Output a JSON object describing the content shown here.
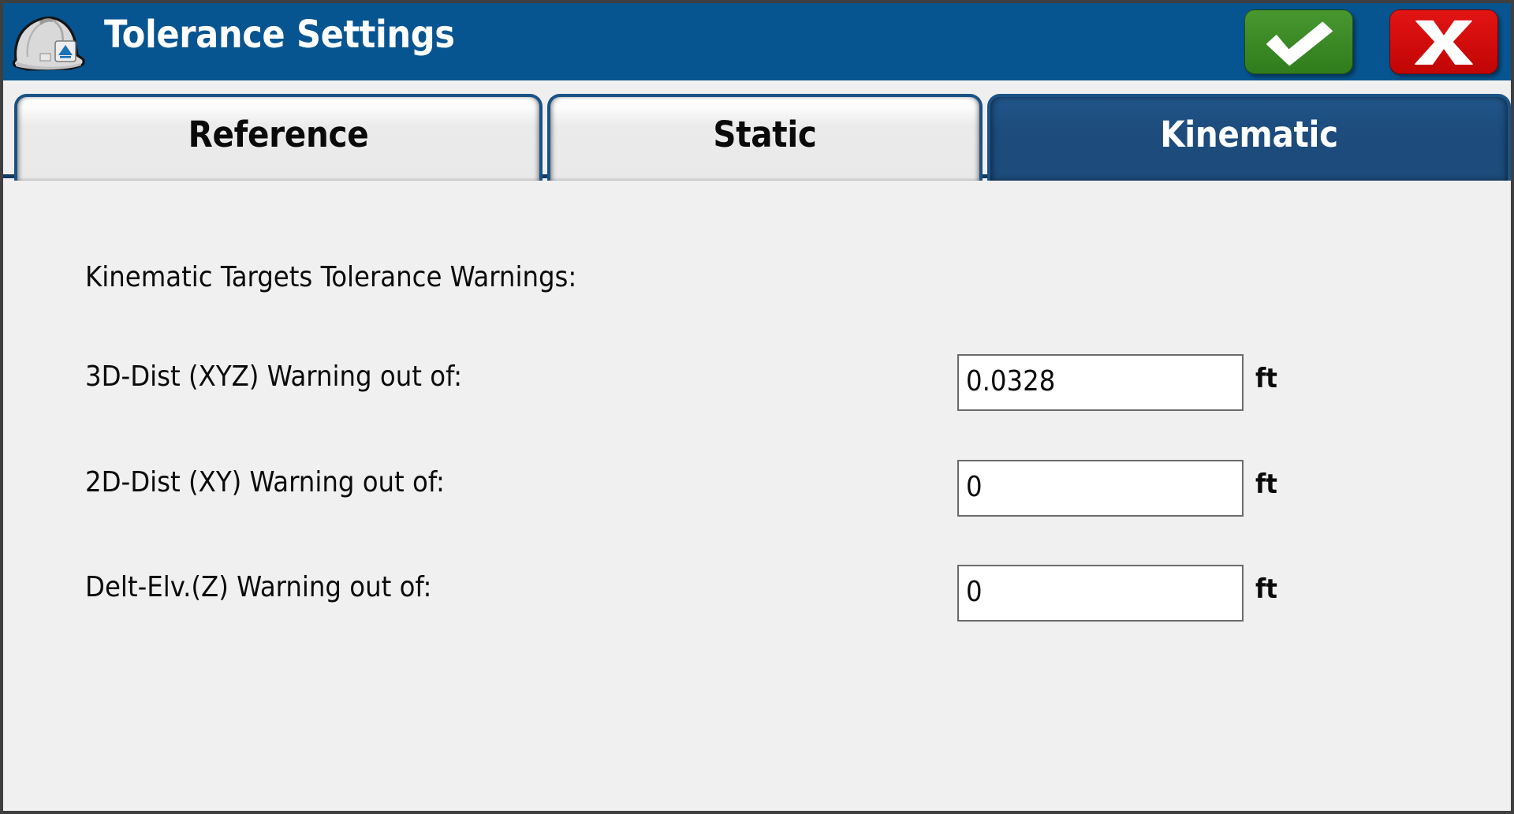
{
  "window": {
    "title": "Tolerance Settings",
    "icon": "hard-hat-icon"
  },
  "titlebar": {
    "accept_label": "✓",
    "cancel_label": "X",
    "accept_icon": "checkmark-icon",
    "cancel_icon": "x-mark-icon",
    "accept_color": "#3d8b27",
    "cancel_color": "#d40d0d",
    "background_color": "#065591"
  },
  "tabs": [
    {
      "id": "reference",
      "label": "Reference",
      "active": false
    },
    {
      "id": "static",
      "label": "Static",
      "active": false
    },
    {
      "id": "kinematic",
      "label": "Kinematic",
      "active": true
    }
  ],
  "content": {
    "heading": "Kinematic Targets Tolerance Warnings:",
    "rows": [
      {
        "label": "3D-Dist (XYZ) Warning out of:",
        "value": "0.0328",
        "unit": "ft"
      },
      {
        "label": "2D-Dist (XY) Warning out of:",
        "value": "0",
        "unit": "ft"
      },
      {
        "label": "Delt-Elv.(Z) Warning out of:",
        "value": "0",
        "unit": "ft"
      }
    ]
  },
  "colors": {
    "header_blue": "#065591",
    "active_tab_blue": "#1d4c7d",
    "tab_border": "#1b5285",
    "page_background": "#f0f0f0",
    "window_border": "#3f3f3f"
  }
}
